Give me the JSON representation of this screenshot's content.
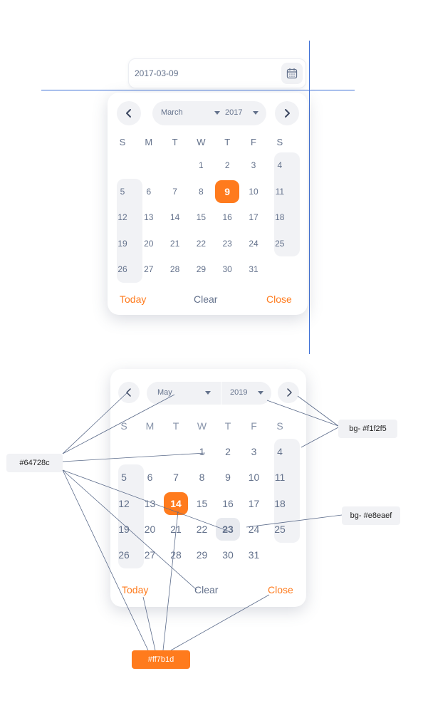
{
  "input": {
    "value": "2017-03-09",
    "icon": "calendar-icon"
  },
  "weekdays": [
    "S",
    "M",
    "T",
    "W",
    "T",
    "F",
    "S"
  ],
  "calendar1": {
    "month": "March",
    "year": "2017",
    "first_weekday": 3,
    "days_in_month": 31,
    "selected_day": 9
  },
  "calendar2": {
    "month": "May",
    "year": "2019",
    "first_weekday": 3,
    "days_in_month": 31,
    "selected_day": 14,
    "hovered_day": 23
  },
  "footer": {
    "today": "Today",
    "clear": "Clear",
    "close": "Close"
  },
  "annotations": {
    "text_color": "#64728c",
    "bg_light": "bg- #f1f2f5",
    "bg_hover": "bg- #e8eaef",
    "accent": "#ff7b1d"
  },
  "colors": {
    "accent": "#ff7b1d",
    "text": "#64728c",
    "bg_light": "#f1f2f5",
    "bg_hover": "#e8eaef"
  }
}
